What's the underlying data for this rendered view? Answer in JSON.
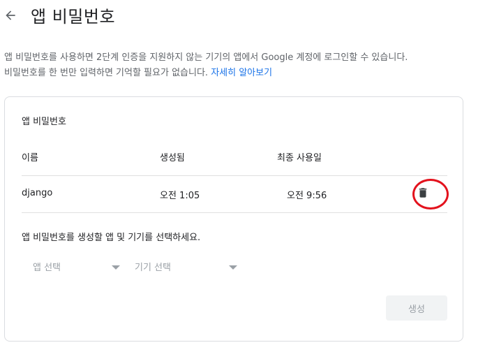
{
  "header": {
    "title": "앱 비밀번호"
  },
  "description": {
    "line1": "앱 비밀번호를 사용하면 2단계 인증을 지원하지 않는 기기의 앱에서 Google 계정에 로그인할 수 있습니다.",
    "line2": "비밀번호를 한 번만 입력하면 기억할 필요가 없습니다.",
    "link": "자세히 알아보기"
  },
  "card": {
    "title": "앱 비밀번호",
    "columns": {
      "name": "이름",
      "created": "생성됨",
      "last_used": "최종 사용일"
    },
    "rows": [
      {
        "name": "django",
        "created": "오전 1:05",
        "last_used": "오전 9:56"
      }
    ],
    "prompt": "앱 비밀번호를 생성할 앱 및 기기를 선택하세요.",
    "app_select": "앱 선택",
    "device_select": "기기 선택",
    "generate_label": "생성"
  },
  "colors": {
    "link": "#1a73e8",
    "highlight": "#e3121d",
    "border": "#dadce0"
  },
  "icons": {
    "back": "arrow-back-icon",
    "delete": "trash-icon",
    "dropdown": "triangle-down-icon"
  }
}
